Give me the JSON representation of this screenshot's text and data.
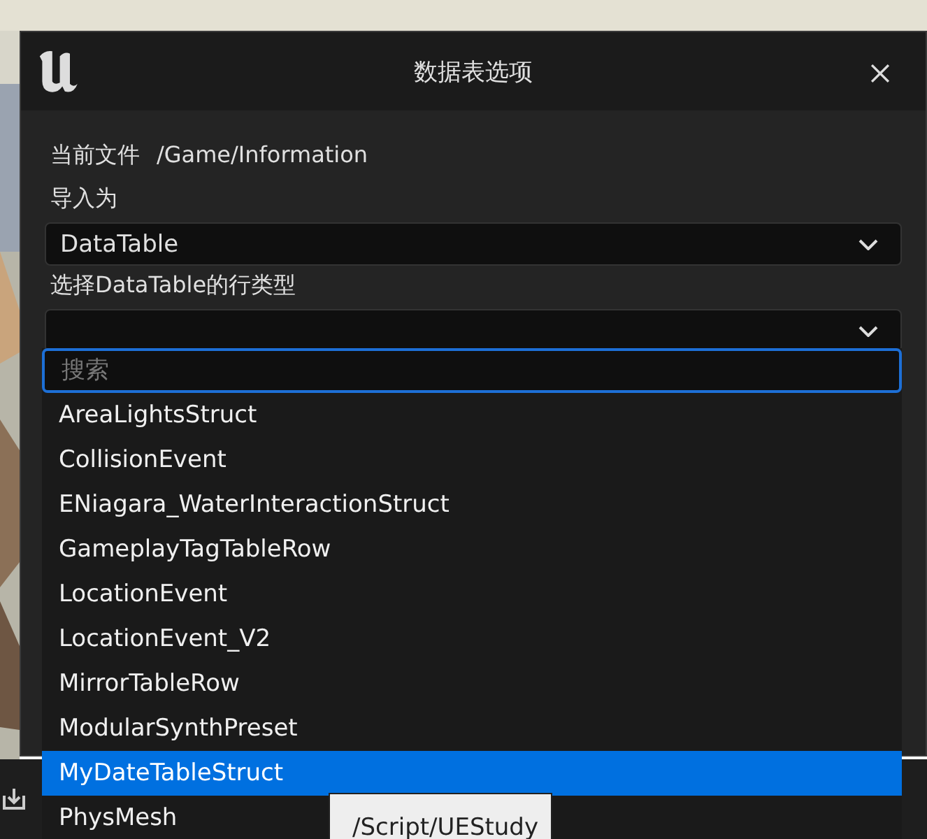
{
  "dialog": {
    "title": "数据表选项",
    "current_file_label": "当前文件",
    "current_file": "/Game/Information",
    "import_as_label": "导入为",
    "import_as_value": "DataTable",
    "row_type_label": "选择DataTable的行类型"
  },
  "dropdown": {
    "search": {
      "placeholder": "搜索"
    },
    "items": [
      {
        "label": "AreaLightsStruct",
        "selected": false
      },
      {
        "label": "CollisionEvent",
        "selected": false
      },
      {
        "label": "ENiagara_WaterInteractionStruct",
        "selected": false
      },
      {
        "label": "GameplayTagTableRow",
        "selected": false
      },
      {
        "label": "LocationEvent",
        "selected": false
      },
      {
        "label": "LocationEvent_V2",
        "selected": false
      },
      {
        "label": "MirrorTableRow",
        "selected": false
      },
      {
        "label": "ModularSynthPreset",
        "selected": false
      },
      {
        "label": "MyDateTableStruct",
        "selected": true
      },
      {
        "label": "PhysMesh",
        "selected": false
      }
    ]
  },
  "tooltip": {
    "text": "/Script/UEStudy"
  }
}
